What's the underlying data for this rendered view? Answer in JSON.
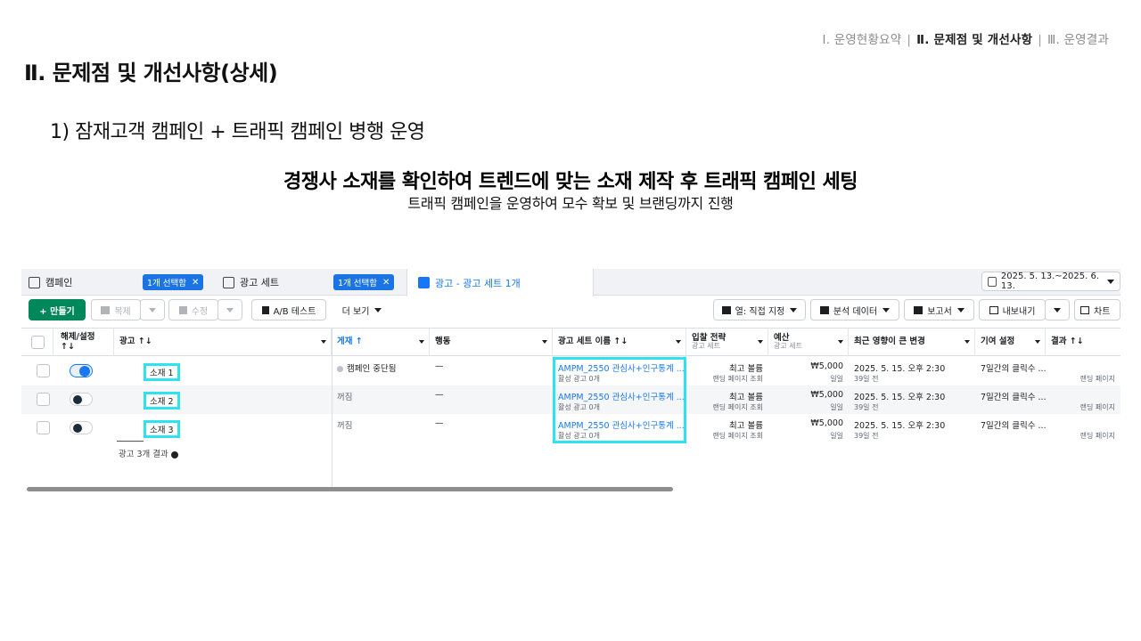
{
  "slide": {
    "breadcrumb": {
      "item1": "Ⅰ. 운영현황요약",
      "item2": "Ⅱ. 문제점 및 개선사항",
      "item3": "Ⅲ. 운영결과"
    },
    "title": "Ⅱ. 문제점 및 개선사항(상세)",
    "subheading": "1) 잠재고객 캠페인 + 트래픽 캠페인 병행 운영",
    "headline": "경쟁사 소재를 확인하여 트렌드에 맞는 소재 제작 후 트래픽 캠페인 세팅",
    "subline": "트래픽 캠페인을 운영하여 모수 확보 및 브랜딩까지 진행",
    "highlight_color": "#2de3f0"
  },
  "ads_manager": {
    "tabs": {
      "campaign": {
        "label": "캠페인",
        "chip": "1개 선택함"
      },
      "adset": {
        "label": "광고 세트",
        "chip": "1개 선택함"
      },
      "ad": {
        "label": "광고 - 광고 세트 1개"
      }
    },
    "date_range": "2025. 5. 13.~2025. 6. 13.",
    "toolbar": {
      "create": "+ 만들기",
      "duplicate": "복제",
      "edit": "수정",
      "ab_test": "A/B 테스트",
      "more": "더 보기",
      "columns": "열: 직접 지정",
      "breakdown": "분석 데이터",
      "reports": "보고서",
      "export": "내보내기",
      "chart": "차트"
    },
    "columns": {
      "toggle": "해제/설정 ↑↓",
      "ad": "광고 ↑↓",
      "delivery": "게재 ↑",
      "actions": "행동",
      "adset_name": "광고 세트 이름 ↑↓",
      "bid_strategy": "입찰 전략",
      "bid_strategy_sub": "광고 세트",
      "budget": "예산",
      "budget_sub": "광고 세트",
      "recent_change": "최근 영향이 큰 변경",
      "attribution": "기여 설정",
      "results": "결과 ↑↓"
    },
    "rows": [
      {
        "toggle_on": true,
        "ad_name": "소재 1",
        "delivery": "캠페인 중단됨",
        "actions": "—",
        "adset_name": "AMPM_2550 관심사+인구통계 ...",
        "adset_sub": "활성 광고 0개",
        "bid": "최고 볼륨",
        "bid_sub": "랜딩 페이지 조회",
        "budget": "₩5,000",
        "budget_sub": "일일",
        "change": "2025. 5. 15. 오후 2:30",
        "change_sub": "39일 전",
        "attribution": "7일간의 클릭수 ...",
        "result_sub": "랜딩 페이지"
      },
      {
        "toggle_on": false,
        "ad_name": "소재 2",
        "delivery": "꺼짐",
        "actions": "—",
        "adset_name": "AMPM_2550 관심사+인구통계 ...",
        "adset_sub": "활성 광고 0개",
        "bid": "최고 볼륨",
        "bid_sub": "랜딩 페이지 조회",
        "budget": "₩5,000",
        "budget_sub": "일일",
        "change": "2025. 5. 15. 오후 2:30",
        "change_sub": "39일 전",
        "attribution": "7일간의 클릭수 ...",
        "result_sub": "랜딩 페이지"
      },
      {
        "toggle_on": false,
        "ad_name": "소재 3",
        "delivery": "꺼짐",
        "actions": "—",
        "adset_name": "AMPM_2550 관심사+인구통계 ...",
        "adset_sub": "활성 광고 0개",
        "bid": "최고 볼륨",
        "bid_sub": "랜딩 페이지 조회",
        "budget": "₩5,000",
        "budget_sub": "일일",
        "change": "2025. 5. 15. 오후 2:30",
        "change_sub": "39일 전",
        "attribution": "7일간의 클릭수 ...",
        "result_sub": "랜딩 페이지"
      }
    ],
    "footer": "광고 3개 결과"
  }
}
